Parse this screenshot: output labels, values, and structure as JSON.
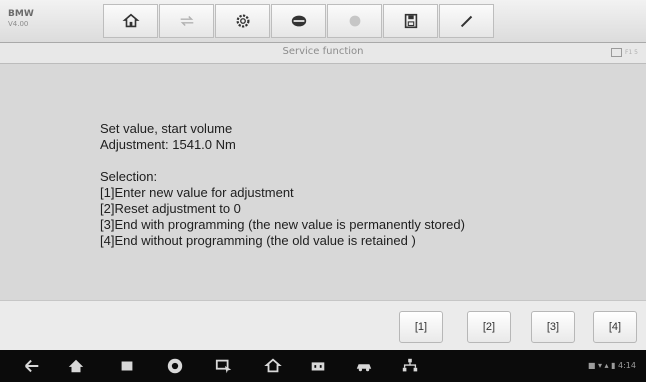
{
  "vehicle": {
    "make": "BMW",
    "sub": "V4.00"
  },
  "toolbar": {
    "buttons": [
      "home-icon",
      "vehicle-swap-icon",
      "settings-icon",
      "dealer-icon",
      "print-icon",
      "save-icon",
      "pen-icon"
    ]
  },
  "titlebar": {
    "title": "Service function",
    "corner_label": "F1 5"
  },
  "message": {
    "line1": "Set value, start volume",
    "line2": "Adjustment: 1541.0 Nm",
    "selection_heading": "Selection:",
    "options": [
      "[1]Enter new value for adjustment",
      "[2]Reset adjustment to 0",
      "[3]End with programming (the new value is permanently stored)",
      "[4]End without programming (the old value is retained )"
    ]
  },
  "buttons": [
    "[1]",
    "[2]",
    "[3]",
    "[4]"
  ],
  "navbar": {
    "icons": [
      "back-icon",
      "home-icon",
      "recent-apps-icon",
      "chrome-icon",
      "screenshot-icon",
      "maxi-home-icon",
      "vci-icon",
      "car-icon",
      "network-icon"
    ],
    "status": "■ ▾ ▴ ▮ 4:14"
  }
}
